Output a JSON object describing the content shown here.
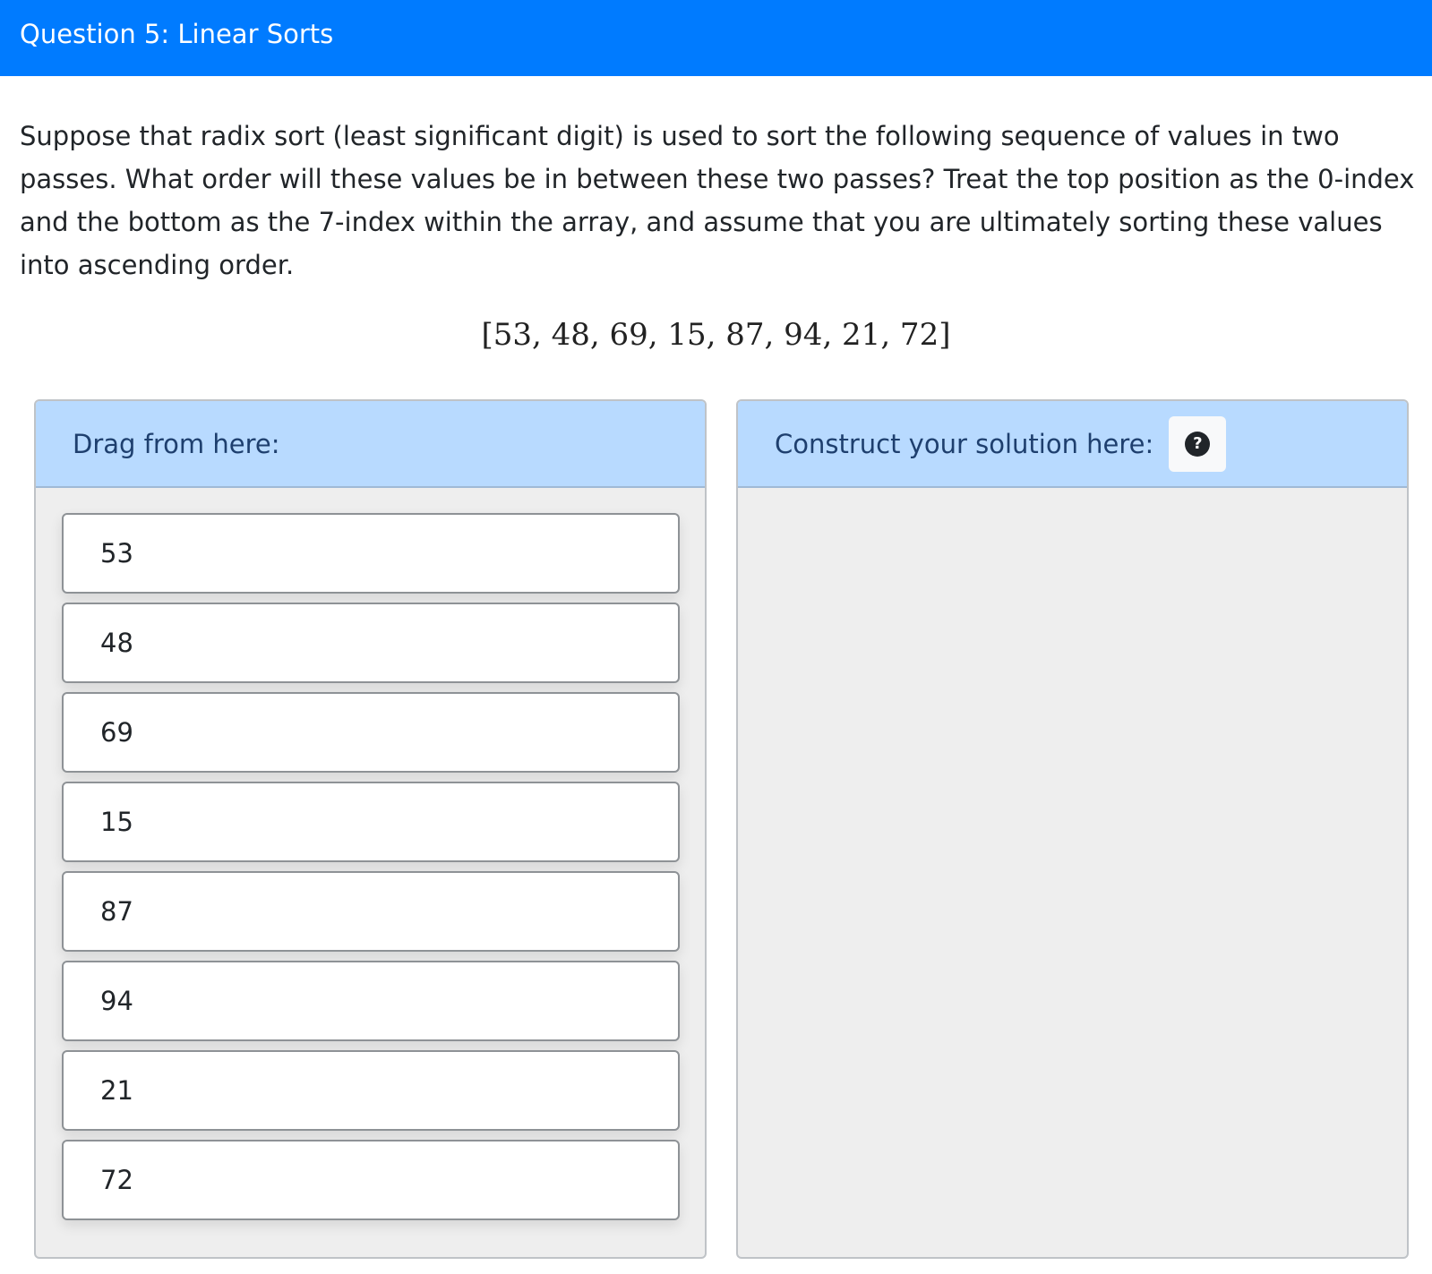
{
  "header": {
    "title": "Question 5: Linear Sorts"
  },
  "question": {
    "text": "Suppose that radix sort (least significant digit) is used to sort the following sequence of values in two passes. What order will these values be in between these two passes? Treat the top position as the 0-index and the bottom as the 7-index within the array, and assume that you are ultimately sorting these values into ascending order.",
    "array": "[53, 48, 69, 15, 87, 94, 21, 72]"
  },
  "source_panel": {
    "label": "Drag from here:",
    "items": [
      "53",
      "48",
      "69",
      "15",
      "87",
      "94",
      "21",
      "72"
    ]
  },
  "solution_panel": {
    "label": "Construct your solution here:",
    "help_icon": "question-circle-icon",
    "help_glyph": "?"
  },
  "colors": {
    "header_bg": "#007bff",
    "panel_header_bg": "#b8daff",
    "panel_bg": "#eeeeee",
    "tile_bg": "#ffffff"
  }
}
